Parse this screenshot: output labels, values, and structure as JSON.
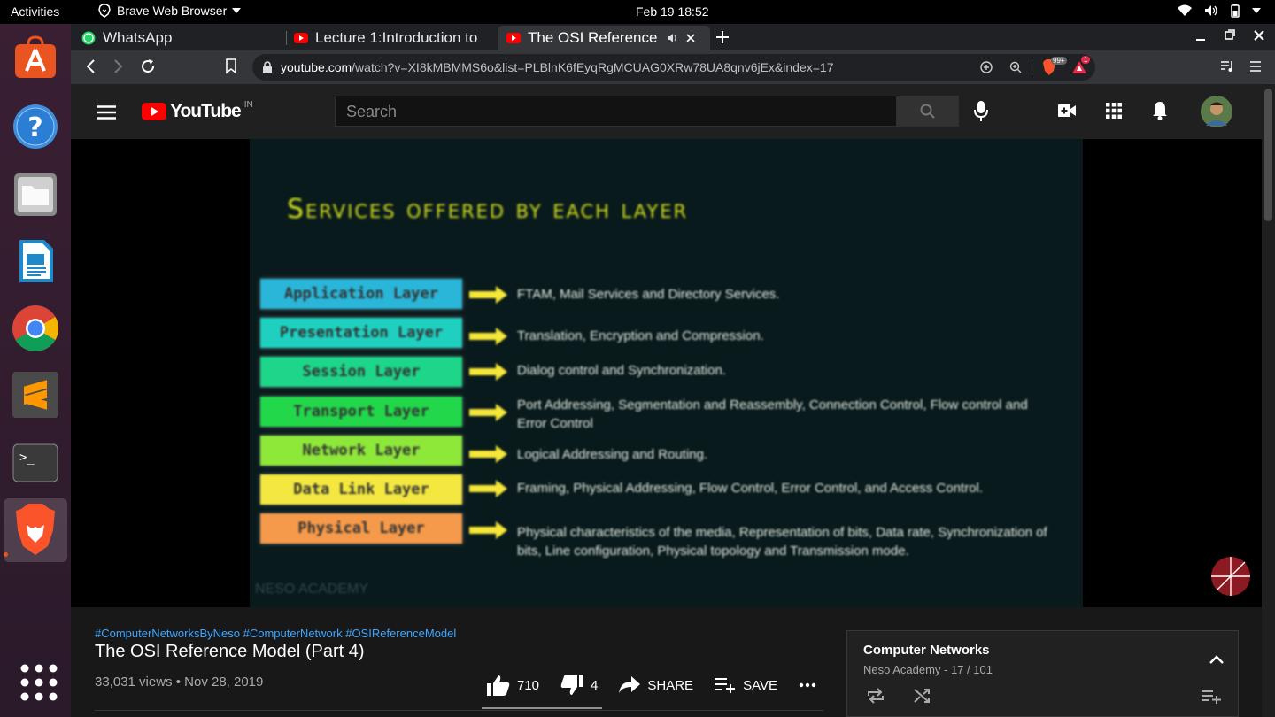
{
  "system_bar": {
    "activities": "Activities",
    "app_name": "Brave Web Browser",
    "clock": "Feb 19  18:52"
  },
  "browser": {
    "tabs": [
      {
        "title": "WhatsApp",
        "icon": "whatsapp-icon",
        "active": false
      },
      {
        "title": "Lecture 1:Introduction to",
        "icon": "youtube-icon",
        "active": false
      },
      {
        "title": "The OSI Reference M",
        "icon": "youtube-icon",
        "active": true
      }
    ],
    "url_host": "youtube.com",
    "url_path": "/watch?v=XI8kMBMMS6o&list=PLBlnK6fEyqRgMCUAG0XRw78UA8qnv6jEx&index=17",
    "brave_shield_badge": "99+",
    "rewards_badge": "1"
  },
  "youtube": {
    "logo_text": "YouTube",
    "region": "IN",
    "search_placeholder": "Search"
  },
  "video": {
    "slide_title": "Services offered by each layer",
    "layers": [
      {
        "name": "Application Layer",
        "color": "#29b6d8",
        "desc": "FTAM, Mail Services and Directory Services."
      },
      {
        "name": "Presentation Layer",
        "color": "#1fd0c0",
        "desc": "Translation, Encryption and Compression."
      },
      {
        "name": "Session Layer",
        "color": "#1ed68a",
        "desc": "Dialog control and Synchronization."
      },
      {
        "name": "Transport Layer",
        "color": "#22d84a",
        "desc": "Port Addressing, Segmentation and Reassembly, Connection Control, Flow control and Error Control"
      },
      {
        "name": "Network Layer",
        "color": "#8ee83a",
        "desc": "Logical Addressing and Routing."
      },
      {
        "name": "Data Link Layer",
        "color": "#f4e840",
        "desc": "Framing, Physical Addressing, Flow Control, Error Control, and Access Control."
      },
      {
        "name": "Physical Layer",
        "color": "#f59a4a",
        "desc": "Physical characteristics of the media, Representation of bits, Data rate, Synchronization of bits, Line configuration, Physical topology and Transmission mode."
      }
    ],
    "watermark": "NESO ACADEMY",
    "hashtags": "#ComputerNetworksByNeso #ComputerNetwork #OSIReferenceModel",
    "title": "The OSI Reference Model (Part 4)",
    "meta": "33,031 views • Nov 28, 2019",
    "likes": "710",
    "dislikes": "4",
    "share_label": "SHARE",
    "save_label": "SAVE"
  },
  "playlist": {
    "title": "Computer Networks",
    "subtitle": "Neso Academy - 17 / 101"
  }
}
